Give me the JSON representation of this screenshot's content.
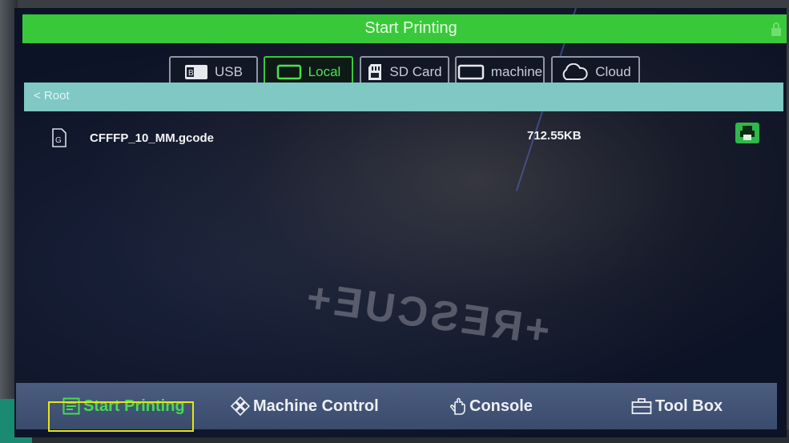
{
  "header": {
    "title": "Start Printing",
    "lock_icon": "lock-icon"
  },
  "tabs": [
    {
      "label": "USB",
      "icon": "usb-icon",
      "active": false
    },
    {
      "label": "Local",
      "icon": "local-storage-icon",
      "active": true
    },
    {
      "label": "SD Card",
      "icon": "sd-card-icon",
      "active": false
    },
    {
      "label": "machine",
      "icon": "machine-icon",
      "active": false
    },
    {
      "label": "Cloud",
      "icon": "cloud-icon",
      "active": false
    }
  ],
  "breadcrumb": {
    "label": "< Root"
  },
  "files": [
    {
      "name": "CFFFP_10_MM.gcode",
      "size": "712.55KB",
      "icon": "gcode-file-icon",
      "action_icon": "print-icon"
    }
  ],
  "bottom_nav": [
    {
      "label": "Start Printing",
      "icon": "list-icon",
      "active": true
    },
    {
      "label": "Machine Control",
      "icon": "dpad-icon",
      "active": false
    },
    {
      "label": "Console",
      "icon": "hand-icon",
      "active": false
    },
    {
      "label": "Tool Box",
      "icon": "toolbox-icon",
      "active": false
    }
  ],
  "colors": {
    "accent_green": "#39c83a",
    "breadcrumb_bg": "#7fc8c3",
    "nav_bg": "#4b5d80",
    "highlight": "#e5e51a"
  }
}
